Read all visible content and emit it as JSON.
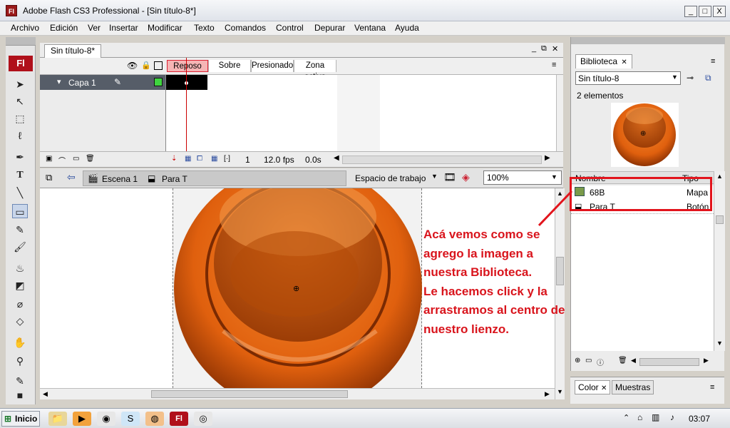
{
  "window": {
    "app_icon": "Fl",
    "title": "Adobe Flash CS3 Professional - [Sin título-8*]",
    "controls": {
      "minimize": "_",
      "maximize": "□",
      "close": "X"
    }
  },
  "menubar": {
    "items": [
      "Archivo",
      "Edición",
      "Ver",
      "Insertar",
      "Modificar",
      "Texto",
      "Comandos",
      "Control",
      "Depurar",
      "Ventana",
      "Ayuda"
    ]
  },
  "tools": {
    "logo": "Fl"
  },
  "document": {
    "tab_label": "Sin título-8*"
  },
  "timeline": {
    "frame_labels": [
      "Reposo",
      "Sobre",
      "Presionado",
      "Zona activa"
    ],
    "active_frame": "Reposo",
    "layer_name": "Capa 1",
    "frame_number": "1",
    "fps": "12.0 fps",
    "time": "0.0s"
  },
  "editbar": {
    "scene_label": "Escena 1",
    "symbol_label": "Para T",
    "workspace_label": "Espacio de trabajo",
    "zoom_value": "100%"
  },
  "library": {
    "tab_label": "Biblioteca",
    "document_select": "Sin título-8",
    "item_count": "2 elementos",
    "column_name": "Nombre",
    "column_type": "Tipo",
    "items": [
      {
        "name": "68B",
        "type": "Mapa"
      },
      {
        "name": "Para T",
        "type": "Botón"
      }
    ]
  },
  "color_panel": {
    "tabs": [
      "Color",
      "Muestras"
    ]
  },
  "annotation": {
    "lines": [
      "Acá vemos como se",
      "agrego la imagen a",
      "nuestra Biblioteca.",
      "Le hacemos click y la",
      "arrastramos al centro de",
      "nuestro lienzo."
    ],
    "color": "#d9141c"
  },
  "taskbar": {
    "start_label": "Inicio",
    "clock": "03:07"
  },
  "colors": {
    "accent_red": "#d9141c",
    "orange": "#e8640f",
    "layer_row": "#565d68"
  }
}
